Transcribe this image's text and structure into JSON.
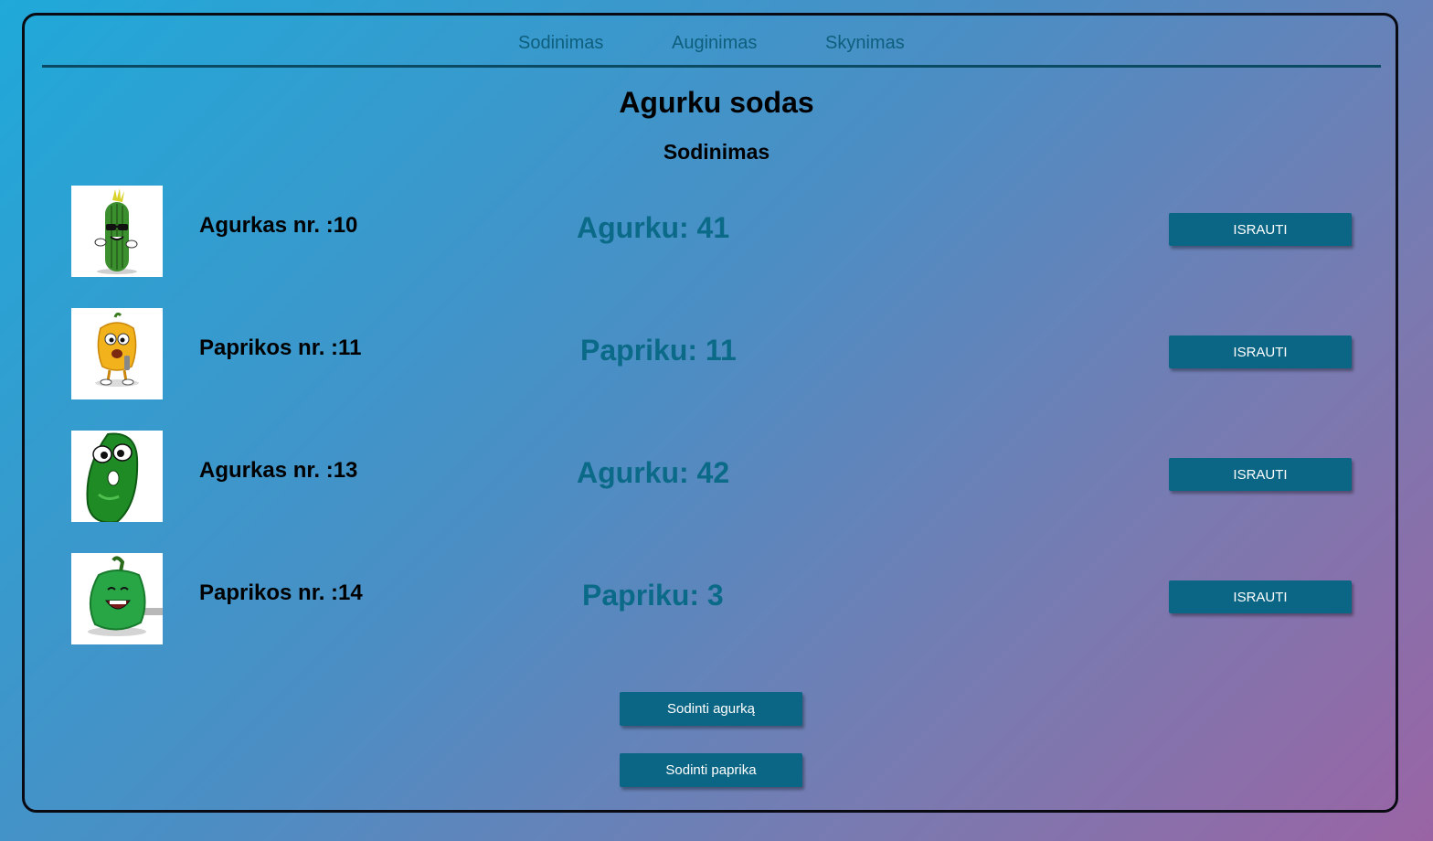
{
  "nav": {
    "items": [
      {
        "label": "Sodinimas"
      },
      {
        "label": "Auginimas"
      },
      {
        "label": "Skynimas"
      }
    ]
  },
  "page": {
    "title": "Agurku sodas",
    "section": "Sodinimas"
  },
  "rows": [
    {
      "name": "Agurkas nr. :10",
      "count": "Agurku: 41",
      "remove_label": "ISRAUTI",
      "image": "sunglasses-cucumber-image"
    },
    {
      "name": "Paprikos nr. :11",
      "count": "Papriku: 11",
      "remove_label": "ISRAUTI",
      "image": "yellow-pepper-singing-image"
    },
    {
      "name": "Agurkas nr. :13",
      "count": "Agurku: 42",
      "remove_label": "ISRAUTI",
      "image": "googly-eyed-cucumber-image"
    },
    {
      "name": "Paprikos nr. :14",
      "count": "Papriku: 3",
      "remove_label": "ISRAUTI",
      "image": "green-pepper-laughing-image"
    }
  ],
  "actions": {
    "plant_cucumber": "Sodinti agurką",
    "plant_pepper": "Sodinti paprika"
  },
  "colors": {
    "accent": "#0b6585",
    "count_text": "#0b6a88",
    "nav_text": "#0e5f7d",
    "nav_rule": "#0b4a63"
  }
}
